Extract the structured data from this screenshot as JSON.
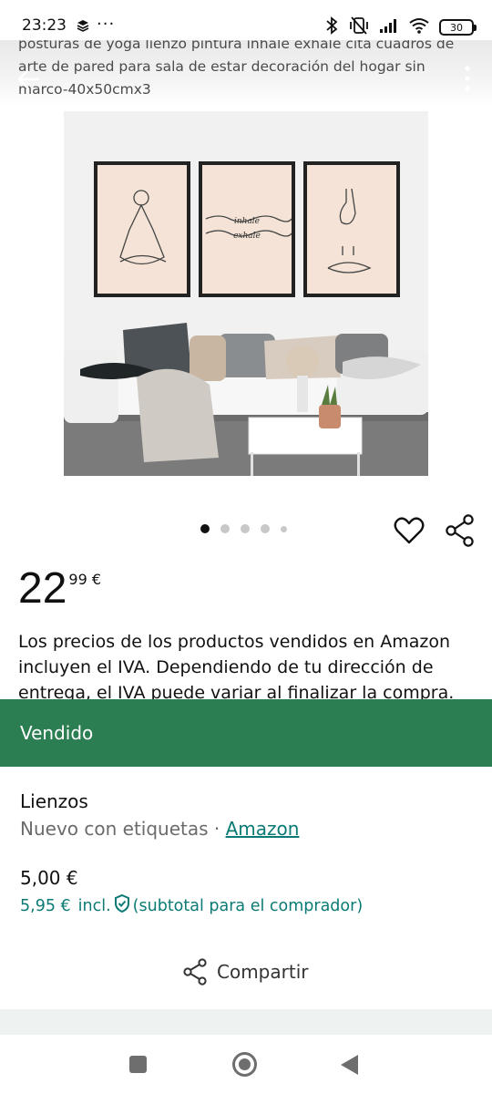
{
  "status_bar": {
    "time": "23:23",
    "more": "···",
    "battery": "30"
  },
  "product": {
    "title": "posturas de yoga lienzo pintura inhale exhale cita cuadros de arte de pared para sala de estar decoración del hogar sin marco-40x50cmx3",
    "image": {
      "poster_middle_top": "inhale",
      "poster_middle_bottom": "exhale"
    },
    "carousel": {
      "total": 5,
      "active": 0
    },
    "price": {
      "whole": "22",
      "fraction": "99 €"
    },
    "vat_note": "Los precios de los productos vendidos en Amazon incluyen el IVA. Dependiendo de tu dirección de entrega, el IVA puede variar al finalizar la compra."
  },
  "sold_sheet": {
    "banner": "Vendido",
    "banner_color": "#2b7d52",
    "category": "Lienzos",
    "condition": "Nuevo con etiquetas · ",
    "source_link": "Amazon",
    "price": "5,00 €",
    "buyer_price": "5,95 €",
    "buyer_incl": "incl.",
    "buyer_subtotal": "(subtotal para el comprador)",
    "share_label": "Compartir",
    "accent_color": "#0b7a75"
  },
  "icons": {
    "back": "arrow-left-icon",
    "more": "more-vertical-icon",
    "favorite": "heart-icon",
    "share": "share-icon",
    "shield": "shield-check-icon"
  }
}
